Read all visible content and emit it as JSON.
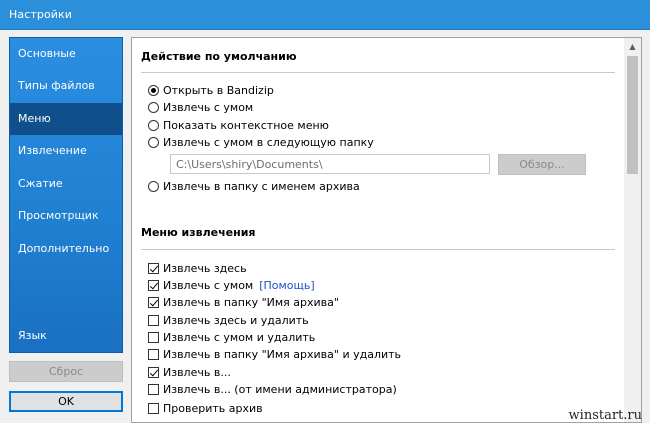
{
  "window": {
    "title": "Настройки"
  },
  "sidebar": {
    "items": [
      {
        "label": "Основные"
      },
      {
        "label": "Типы файлов"
      },
      {
        "label": "Меню",
        "active": true
      },
      {
        "label": "Извлечение"
      },
      {
        "label": "Сжатие"
      },
      {
        "label": "Просмотрщик"
      },
      {
        "label": "Дополнительно"
      },
      {
        "label": "Язык"
      }
    ],
    "reset_label": "Сброс",
    "ok_label": "OK"
  },
  "main": {
    "default_action": {
      "title": "Действие по умолчанию",
      "options": [
        {
          "label": "Открыть в Bandizip",
          "selected": true
        },
        {
          "label": "Извлечь с умом",
          "selected": false
        },
        {
          "label": "Показать контекстное меню",
          "selected": false
        },
        {
          "label": "Извлечь с умом в следующую папку",
          "selected": false
        },
        {
          "label": "Извлечь в папку с именем архива",
          "selected": false
        }
      ],
      "folder_path": "C:\\Users\\shiry\\Documents\\",
      "browse_label": "Обзор..."
    },
    "extract_menu": {
      "title": "Меню извлечения",
      "help_link": "[Помощь]",
      "items": [
        {
          "label": "Извлечь здесь",
          "checked": true
        },
        {
          "label": "Извлечь с умом",
          "checked": true
        },
        {
          "label": "Извлечь в папку \"Имя архива\"",
          "checked": true
        },
        {
          "label": "Извлечь здесь и удалить",
          "checked": false
        },
        {
          "label": "Извлечь с умом и удалить",
          "checked": false
        },
        {
          "label": "Извлечь в папку \"Имя архива\" и удалить",
          "checked": false
        },
        {
          "label": "Извлечь в...",
          "checked": true
        },
        {
          "label": "Извлечь в... (от имени администратора)",
          "checked": false
        },
        {
          "label": "Проверить архив",
          "checked": false
        }
      ]
    }
  },
  "watermark": "winstart.ru"
}
